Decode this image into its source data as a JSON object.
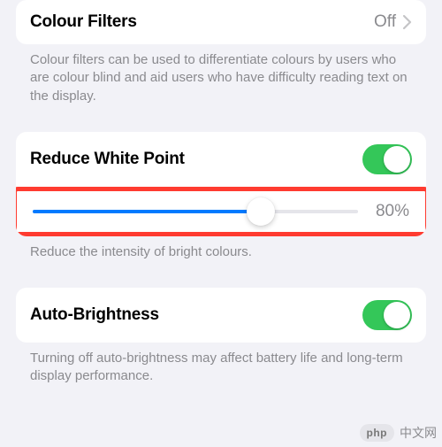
{
  "colour_filters": {
    "label": "Colour Filters",
    "value": "Off",
    "help": "Colour filters can be used to differentiate colours by users who are colour blind and aid users who have difficulty reading text on the display."
  },
  "reduce_white_point": {
    "label": "Reduce White Point",
    "toggle_on": true,
    "slider_percent": 80,
    "slider_display": "80%",
    "help": "Reduce the intensity of bright colours."
  },
  "auto_brightness": {
    "label": "Auto-Brightness",
    "toggle_on": true,
    "help": "Turning off auto-brightness may affect battery life and long-term display performance."
  },
  "watermark": {
    "pill": "php",
    "text": "中文网"
  },
  "colors": {
    "accent_blue": "#007aff",
    "toggle_green": "#34c759",
    "highlight_red": "#ff3b30"
  }
}
